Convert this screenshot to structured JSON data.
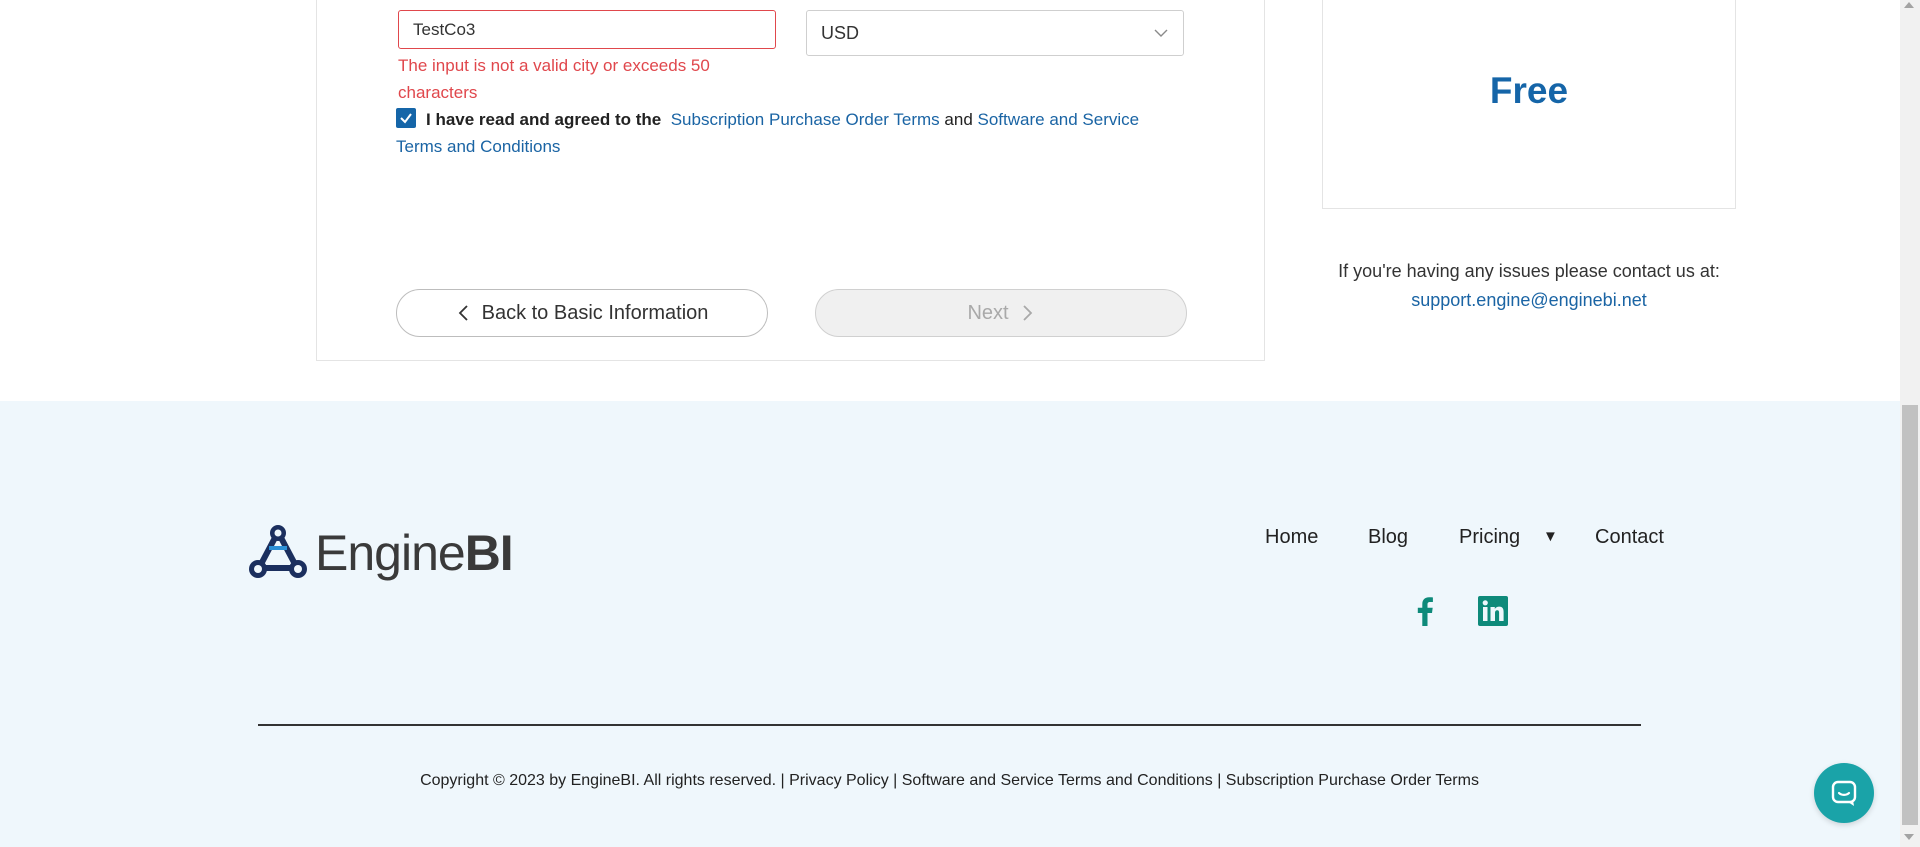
{
  "form": {
    "city_value": "TestCo3",
    "city_error": "The input is not a valid city or exceeds 50 characters",
    "currency_value": "USD",
    "agree_prefix": "I have read and agreed to the",
    "agree_link1": "Subscription Purchase Order Terms",
    "agree_and": "and",
    "agree_link2": "Software and Service Terms and Conditions",
    "agree_checked": true,
    "back_label": "Back to Basic Information",
    "next_label": "Next"
  },
  "plan": {
    "price": "Free"
  },
  "support": {
    "text": "If you're having any issues please contact us at:",
    "email": "support.engine@enginebi.net"
  },
  "footer": {
    "logo_text_light": "Engine",
    "logo_text_bold": "BI",
    "nav": {
      "home": "Home",
      "blog": "Blog",
      "pricing": "Pricing",
      "contact": "Contact"
    },
    "copyright": "Copyright © 2023 by EngineBI. All rights reserved.",
    "sep": "|",
    "privacy": "Privacy Policy",
    "sst": "Software and Service Terms and Conditions",
    "spot": "Subscription Purchase Order Terms"
  },
  "colors": {
    "brand_blue": "#1565a8",
    "link_blue": "#1a64a4",
    "error_red": "#e0474c",
    "social_teal": "#0e8a7a",
    "chat_teal": "#1aa3a8",
    "footer_bg": "#eff7fc"
  },
  "icons": {
    "checkbox": "check-icon",
    "back": "chevron-left-icon",
    "next": "chevron-right-icon",
    "select": "chevron-down-icon",
    "facebook": "facebook-icon",
    "linkedin": "linkedin-icon",
    "chat": "chat-icon",
    "pricing_caret": "caret-down-icon"
  }
}
